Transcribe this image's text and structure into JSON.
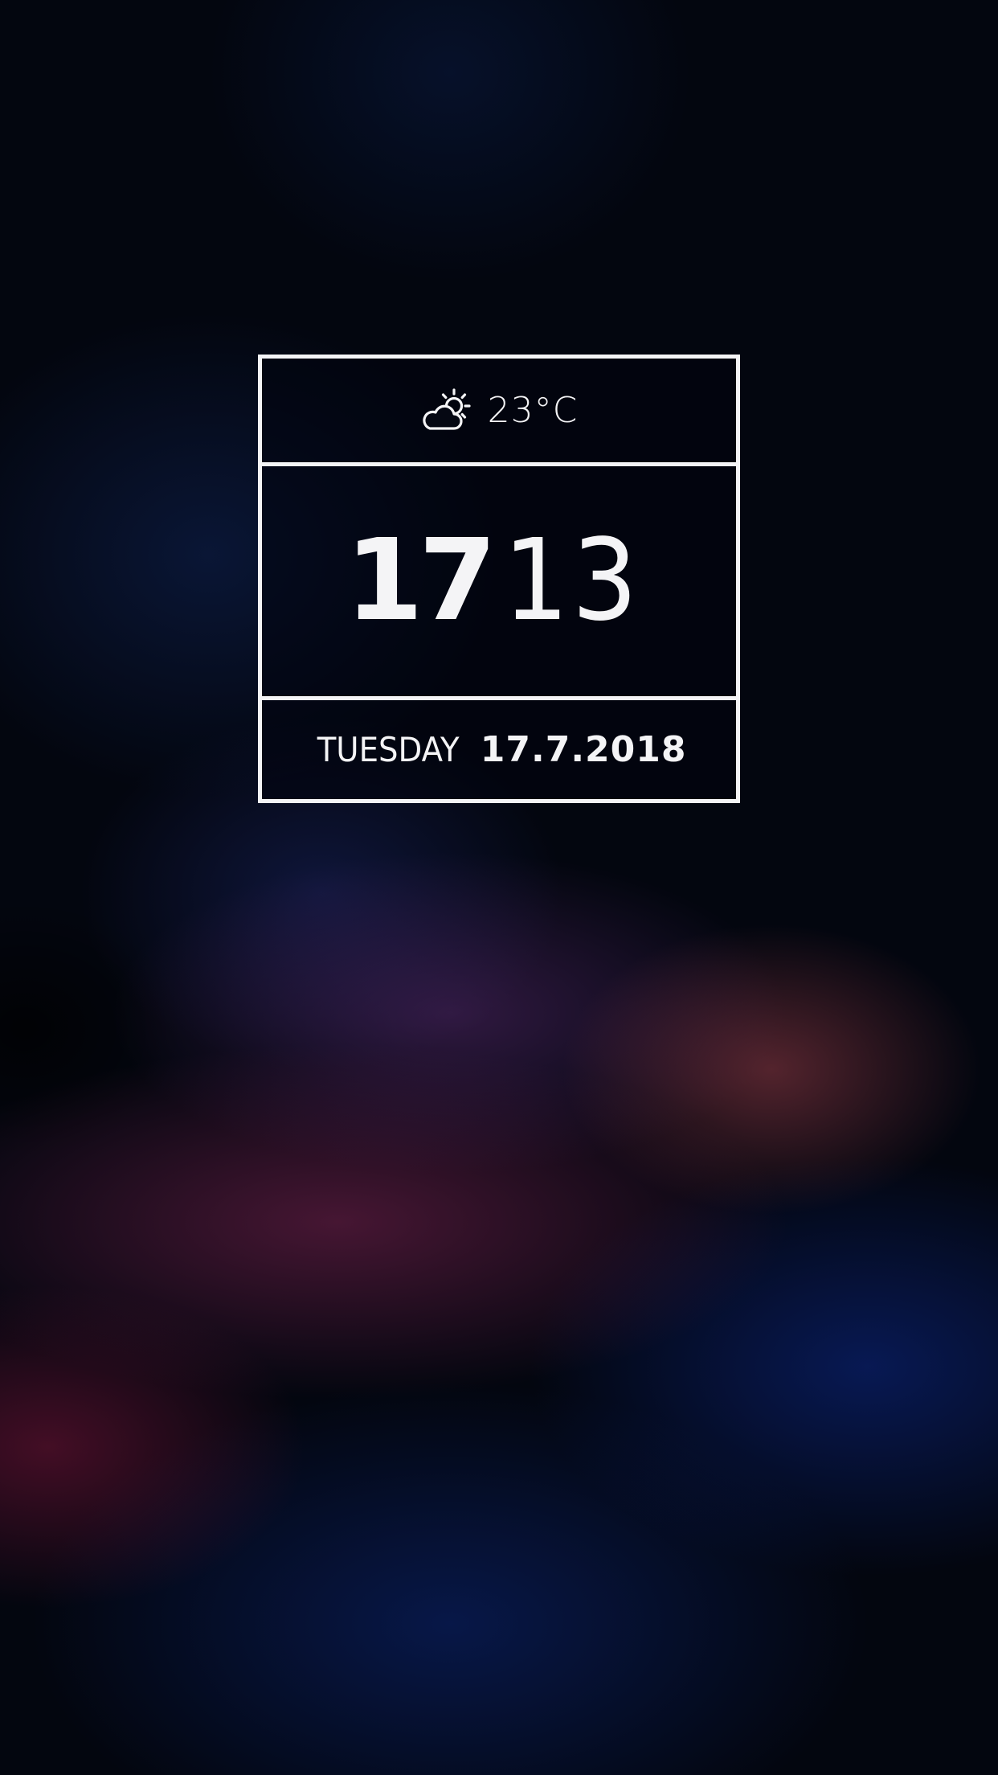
{
  "widget": {
    "weather": {
      "icon": "partly-cloudy-icon",
      "temperature": "23°C"
    },
    "time": {
      "hours": "17",
      "minutes": "13"
    },
    "date": {
      "weekday": "TUESDAY",
      "date": "17.7.2018"
    }
  },
  "colors": {
    "foreground": "#f4f4f6",
    "background": "#03060f"
  }
}
